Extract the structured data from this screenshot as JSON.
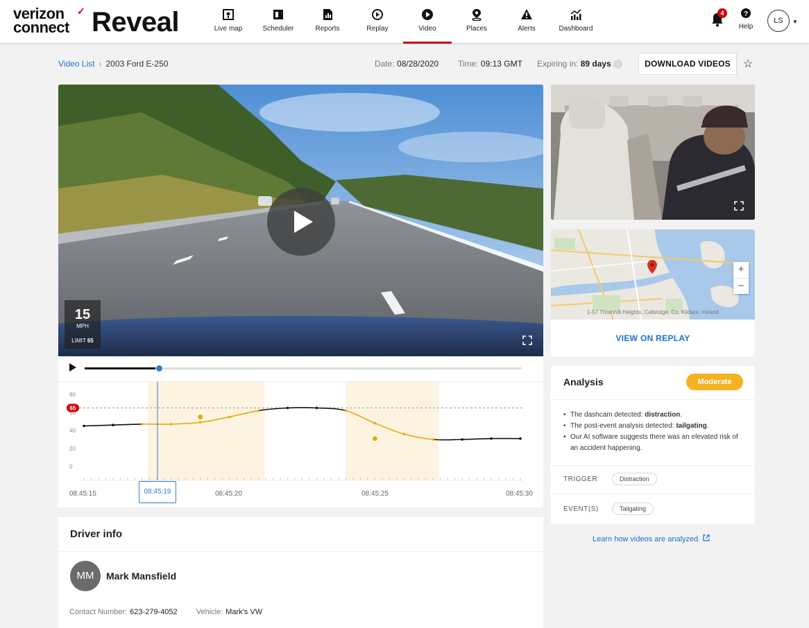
{
  "brand": {
    "line1": "verizon",
    "line2": "connect",
    "product": "Reveal"
  },
  "nav": [
    {
      "label": "Live map",
      "icon": "live-map-icon"
    },
    {
      "label": "Scheduler",
      "icon": "scheduler-icon"
    },
    {
      "label": "Reports",
      "icon": "reports-icon"
    },
    {
      "label": "Replay",
      "icon": "replay-icon"
    },
    {
      "label": "Video",
      "icon": "video-icon",
      "active": true
    },
    {
      "label": "Places",
      "icon": "places-icon"
    },
    {
      "label": "Alerts",
      "icon": "alerts-icon"
    },
    {
      "label": "Dashboard",
      "icon": "dashboard-icon"
    }
  ],
  "notifications": {
    "count": "4"
  },
  "help": {
    "label": "Help"
  },
  "user": {
    "initials": "LS"
  },
  "breadcrumb": {
    "parent": "Video List",
    "current": "2003 Ford E-250"
  },
  "meta": {
    "date_label": "Date:",
    "date": "08/28/2020",
    "time_label": "Time:",
    "time": "09:13 GMT",
    "expiring_label": "Expiring in:",
    "expiring": "89 days"
  },
  "download_label": "DOWNLOAD VIDEOS",
  "video": {
    "speed": "15",
    "unit": "MPH",
    "limit_label": "LIMIT",
    "limit": "65"
  },
  "timeline": {
    "progress": 0.17,
    "y_ticks": [
      "80",
      "60",
      "40",
      "20",
      "0"
    ],
    "limit_marker": "65",
    "time_ticks": [
      "08:45:15",
      "08:45:20",
      "08:45:25",
      "08:45:30"
    ],
    "current_time": "08:45:19"
  },
  "chart_data": {
    "type": "line",
    "x": [
      0,
      1,
      2,
      3,
      4,
      5,
      6,
      7,
      8,
      9,
      10,
      11,
      12,
      13,
      14,
      15
    ],
    "series": [
      {
        "values": [
          45,
          46,
          47,
          47,
          49,
          55,
          62,
          65,
          65,
          62,
          48,
          36,
          30,
          30,
          31,
          31
        ]
      }
    ],
    "highlight_points": [
      {
        "x": 4,
        "y": 55
      },
      {
        "x": 10,
        "y": 31
      }
    ],
    "limit": 65,
    "ylim": [
      0,
      80
    ],
    "colors": {
      "normal": "#111111",
      "event": "#e8a80c",
      "limit": "#cd040b",
      "event_band": "#fdf3e1"
    }
  },
  "driver": {
    "heading": "Driver info",
    "initials": "MM",
    "name": "Mark Mansfield",
    "contact_label": "Contact Number:",
    "contact": "623-279-4052",
    "vehicle_label": "Vehicle:",
    "vehicle": "Mark's VW"
  },
  "map": {
    "address": "1-57 Thornhill Heights, Celbridge, Co. Kildare, Ireland",
    "link": "VIEW ON REPLAY"
  },
  "analysis": {
    "title": "Analysis",
    "severity": "Moderate",
    "points": [
      {
        "pre": "The dashcam detected: ",
        "strong": "distraction",
        "post": "."
      },
      {
        "pre": "The post-event analysis detected: ",
        "strong": "tailgating",
        "post": "."
      },
      {
        "pre": "Our AI software suggests there was an elevated risk of an accident happening.",
        "strong": "",
        "post": ""
      }
    ],
    "trigger_label": "TRIGGER",
    "trigger": "Distraction",
    "events_label": "EVENT(S)",
    "event": "Tailgating"
  },
  "learn_link": "Learn how videos are analyzed"
}
